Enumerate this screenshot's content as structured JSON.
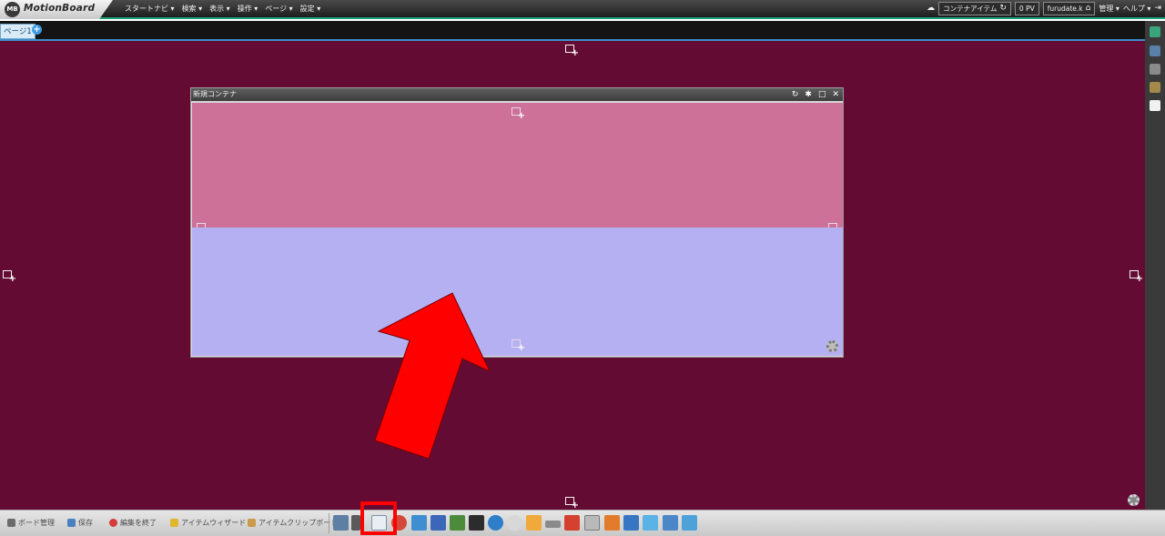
{
  "app": {
    "logo_badge": "MB",
    "logo_text": "MotionBoard"
  },
  "menu": [
    {
      "label": "スタートナビ ▾"
    },
    {
      "label": "検索 ▾"
    },
    {
      "label": "表示 ▾"
    },
    {
      "label": "操作 ▾"
    },
    {
      "label": "ページ ▾"
    },
    {
      "label": "設定 ▾"
    }
  ],
  "header_right": {
    "container_item_label": "コンテナアイテム",
    "pv_label": "0 PV",
    "user_label": "furudate.k",
    "admin_label": "管理 ▾",
    "help_label": "ヘルプ ▾"
  },
  "tabs": {
    "active_label": "ページ1",
    "add_label": "+"
  },
  "container": {
    "title": "新規コンテナ",
    "buttons": {
      "refresh": "↻",
      "settings": "✱",
      "maximize": "□",
      "close": "✕"
    },
    "top_pane_color": "#cd7198",
    "bottom_pane_color": "#b4b0f2"
  },
  "board": {
    "background": "#640b34"
  },
  "bottom_toolbar": {
    "items": [
      {
        "label": "ボード管理"
      },
      {
        "label": "保存"
      },
      {
        "label": "編集を終了"
      },
      {
        "label": "アイテムウィザード"
      },
      {
        "label": "アイテムクリップボード"
      }
    ]
  },
  "annotation": {
    "arrow_color": "#ff0000",
    "highlight_color": "#ff0000"
  }
}
